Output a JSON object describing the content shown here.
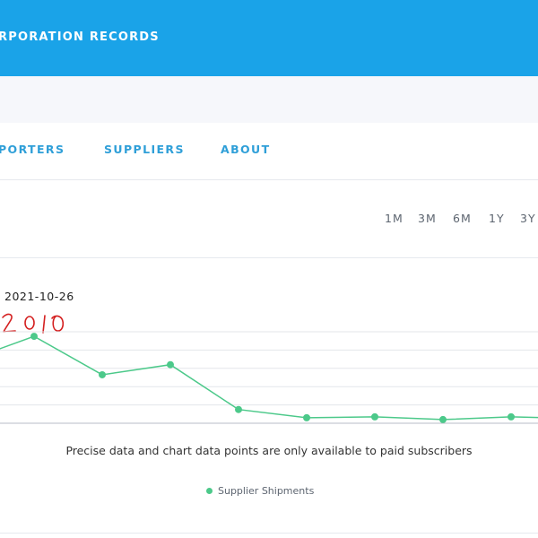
{
  "header": {
    "title": "RPORATION RECORDS",
    "color": "#1aa3e8"
  },
  "nav": {
    "items": [
      {
        "label": "PORTERS"
      },
      {
        "label": "SUPPLIERS"
      },
      {
        "label": "ABOUT"
      }
    ]
  },
  "range_buttons": [
    "1M",
    "3M",
    "6M",
    "1Y",
    "3Y"
  ],
  "chart": {
    "date_label": "2021-10-26",
    "annotation": "2010",
    "notice": "Precise data and chart data points are only available to paid subscribers",
    "legend_label": "Supplier Shipments",
    "series_color": "#4cc98a"
  },
  "chart_data": {
    "type": "line",
    "title": "",
    "xlabel": "",
    "ylabel": "",
    "ylim": [
      0,
      100
    ],
    "grid": true,
    "legend": "bottom",
    "series": [
      {
        "name": "Supplier Shipments",
        "values": [
          68,
          95,
          53,
          64,
          15,
          6,
          7,
          4,
          7,
          5
        ]
      }
    ]
  }
}
